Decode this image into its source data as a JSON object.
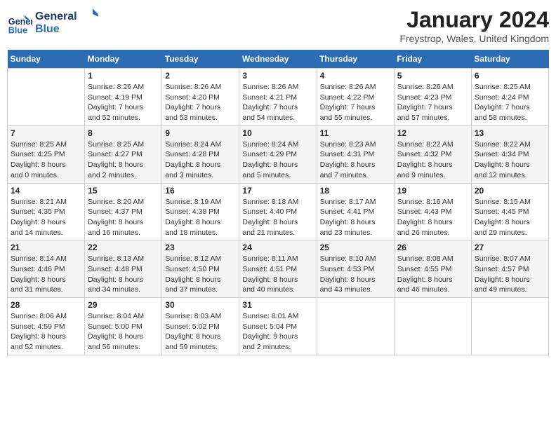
{
  "logo": {
    "line1": "General",
    "line2": "Blue"
  },
  "title": "January 2024",
  "location": "Freystrop, Wales, United Kingdom",
  "days_of_week": [
    "Sunday",
    "Monday",
    "Tuesday",
    "Wednesday",
    "Thursday",
    "Friday",
    "Saturday"
  ],
  "weeks": [
    [
      {
        "day": "",
        "info": ""
      },
      {
        "day": "1",
        "info": "Sunrise: 8:26 AM\nSunset: 4:19 PM\nDaylight: 7 hours\nand 52 minutes."
      },
      {
        "day": "2",
        "info": "Sunrise: 8:26 AM\nSunset: 4:20 PM\nDaylight: 7 hours\nand 53 minutes."
      },
      {
        "day": "3",
        "info": "Sunrise: 8:26 AM\nSunset: 4:21 PM\nDaylight: 7 hours\nand 54 minutes."
      },
      {
        "day": "4",
        "info": "Sunrise: 8:26 AM\nSunset: 4:22 PM\nDaylight: 7 hours\nand 55 minutes."
      },
      {
        "day": "5",
        "info": "Sunrise: 8:26 AM\nSunset: 4:23 PM\nDaylight: 7 hours\nand 57 minutes."
      },
      {
        "day": "6",
        "info": "Sunrise: 8:25 AM\nSunset: 4:24 PM\nDaylight: 7 hours\nand 58 minutes."
      }
    ],
    [
      {
        "day": "7",
        "info": "Sunrise: 8:25 AM\nSunset: 4:25 PM\nDaylight: 8 hours\nand 0 minutes."
      },
      {
        "day": "8",
        "info": "Sunrise: 8:25 AM\nSunset: 4:27 PM\nDaylight: 8 hours\nand 2 minutes."
      },
      {
        "day": "9",
        "info": "Sunrise: 8:24 AM\nSunset: 4:28 PM\nDaylight: 8 hours\nand 3 minutes."
      },
      {
        "day": "10",
        "info": "Sunrise: 8:24 AM\nSunset: 4:29 PM\nDaylight: 8 hours\nand 5 minutes."
      },
      {
        "day": "11",
        "info": "Sunrise: 8:23 AM\nSunset: 4:31 PM\nDaylight: 8 hours\nand 7 minutes."
      },
      {
        "day": "12",
        "info": "Sunrise: 8:22 AM\nSunset: 4:32 PM\nDaylight: 8 hours\nand 9 minutes."
      },
      {
        "day": "13",
        "info": "Sunrise: 8:22 AM\nSunset: 4:34 PM\nDaylight: 8 hours\nand 12 minutes."
      }
    ],
    [
      {
        "day": "14",
        "info": "Sunrise: 8:21 AM\nSunset: 4:35 PM\nDaylight: 8 hours\nand 14 minutes."
      },
      {
        "day": "15",
        "info": "Sunrise: 8:20 AM\nSunset: 4:37 PM\nDaylight: 8 hours\nand 16 minutes."
      },
      {
        "day": "16",
        "info": "Sunrise: 8:19 AM\nSunset: 4:38 PM\nDaylight: 8 hours\nand 18 minutes."
      },
      {
        "day": "17",
        "info": "Sunrise: 8:18 AM\nSunset: 4:40 PM\nDaylight: 8 hours\nand 21 minutes."
      },
      {
        "day": "18",
        "info": "Sunrise: 8:17 AM\nSunset: 4:41 PM\nDaylight: 8 hours\nand 23 minutes."
      },
      {
        "day": "19",
        "info": "Sunrise: 8:16 AM\nSunset: 4:43 PM\nDaylight: 8 hours\nand 26 minutes."
      },
      {
        "day": "20",
        "info": "Sunrise: 8:15 AM\nSunset: 4:45 PM\nDaylight: 8 hours\nand 29 minutes."
      }
    ],
    [
      {
        "day": "21",
        "info": "Sunrise: 8:14 AM\nSunset: 4:46 PM\nDaylight: 8 hours\nand 31 minutes."
      },
      {
        "day": "22",
        "info": "Sunrise: 8:13 AM\nSunset: 4:48 PM\nDaylight: 8 hours\nand 34 minutes."
      },
      {
        "day": "23",
        "info": "Sunrise: 8:12 AM\nSunset: 4:50 PM\nDaylight: 8 hours\nand 37 minutes."
      },
      {
        "day": "24",
        "info": "Sunrise: 8:11 AM\nSunset: 4:51 PM\nDaylight: 8 hours\nand 40 minutes."
      },
      {
        "day": "25",
        "info": "Sunrise: 8:10 AM\nSunset: 4:53 PM\nDaylight: 8 hours\nand 43 minutes."
      },
      {
        "day": "26",
        "info": "Sunrise: 8:08 AM\nSunset: 4:55 PM\nDaylight: 8 hours\nand 46 minutes."
      },
      {
        "day": "27",
        "info": "Sunrise: 8:07 AM\nSunset: 4:57 PM\nDaylight: 8 hours\nand 49 minutes."
      }
    ],
    [
      {
        "day": "28",
        "info": "Sunrise: 8:06 AM\nSunset: 4:59 PM\nDaylight: 8 hours\nand 52 minutes."
      },
      {
        "day": "29",
        "info": "Sunrise: 8:04 AM\nSunset: 5:00 PM\nDaylight: 8 hours\nand 56 minutes."
      },
      {
        "day": "30",
        "info": "Sunrise: 8:03 AM\nSunset: 5:02 PM\nDaylight: 8 hours\nand 59 minutes."
      },
      {
        "day": "31",
        "info": "Sunrise: 8:01 AM\nSunset: 5:04 PM\nDaylight: 9 hours\nand 2 minutes."
      },
      {
        "day": "",
        "info": ""
      },
      {
        "day": "",
        "info": ""
      },
      {
        "day": "",
        "info": ""
      }
    ]
  ]
}
